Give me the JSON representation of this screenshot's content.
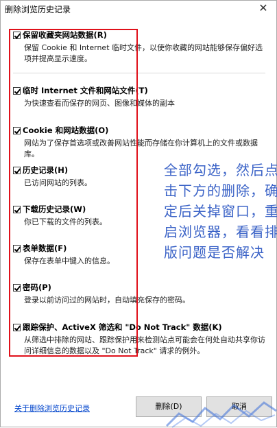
{
  "window": {
    "title": "删除浏览历史记录",
    "close_symbol": "✕"
  },
  "options": [
    {
      "title": "保留收藏夹网站数据(R)",
      "desc": "保留 Cookie 和 Internet 临时文件，以使你收藏的网站能够保存偏好选项并提高显示速度。",
      "checked": true
    },
    {
      "title": "临时 Internet 文件和网站文件(T)",
      "desc": "为快速查看而保存的网页、图像和媒体的副本",
      "checked": true
    },
    {
      "title": "Cookie 和网站数据(O)",
      "desc": "网站为了保存首选项或改善网站性能而存储在你计算机上的文件或数据库。",
      "checked": true
    },
    {
      "title": "历史记录(H)",
      "desc": "已访问网站的列表。",
      "checked": true
    },
    {
      "title": "下载历史记录(W)",
      "desc": "你已下载的文件的列表。",
      "checked": true
    },
    {
      "title": "表单数据(F)",
      "desc": "保存在表单中键入的信息。",
      "checked": true
    },
    {
      "title": "密码(P)",
      "desc": "登录以前访问过的网站时，自动填充保存的密码。",
      "checked": true
    },
    {
      "title": "跟踪保护、ActiveX 筛选和 \"Do Not Track\" 数据(K)",
      "desc": "从筛选中排除的网站、跟踪保护用来检测站点可能会在何处自动共享你访问详细信息的数据以及 \"Do Not Track\" 请求的例外。",
      "checked": true
    }
  ],
  "annotation": {
    "text": "全部勾选，然后点击下方的删除，确定后关掉窗口，重启浏览器，看看排版问题是否解决",
    "color": "#3b63c7"
  },
  "footer": {
    "about_link": "关于删除浏览历史记录",
    "delete_label": "删除(D)",
    "cancel_label": "取消"
  },
  "colors": {
    "highlight_box": "#e0101a",
    "link": "#0044cc"
  }
}
